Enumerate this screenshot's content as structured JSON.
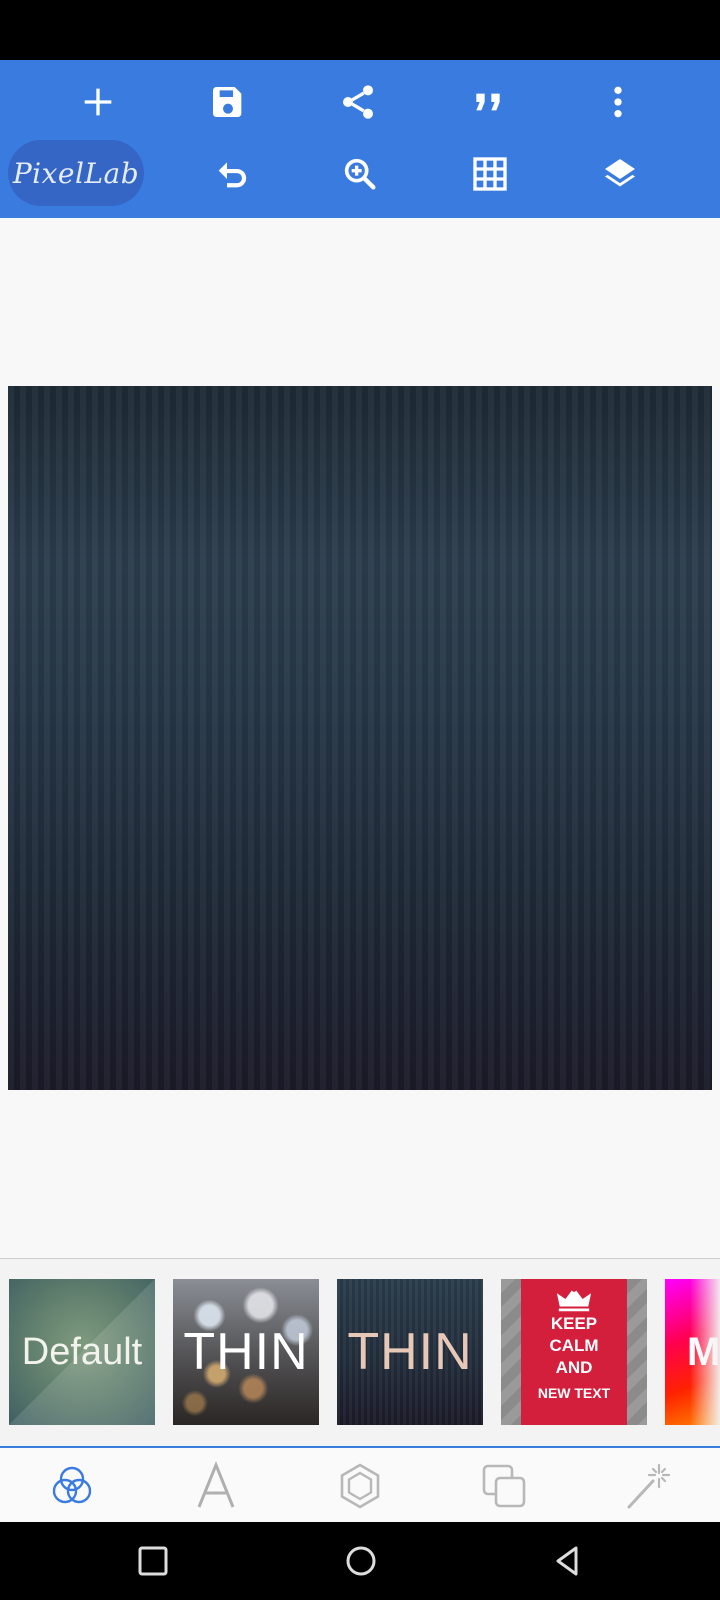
{
  "app": {
    "logo_text": "PixelLab",
    "accent_color": "#3a7be0"
  },
  "toolbar": {
    "top_row": [
      "plus-icon",
      "save-icon",
      "share-icon",
      "quote-icon",
      "more-vert-icon"
    ],
    "bottom_row": [
      "undo-icon",
      "zoom-in-icon",
      "grid-icon",
      "layers-icon"
    ]
  },
  "presets": {
    "default_label": "Default",
    "thin_label": "THIN",
    "thin2_label": "THIN",
    "keep_line1": "KEEP",
    "keep_line2": "CALM",
    "keep_line3": "AND",
    "keep_line4": "NEW TEXT",
    "partial_label": "M"
  },
  "bottom_tabs": [
    "blend-icon",
    "text-icon",
    "shape-icon",
    "copy-icon",
    "magic-wand-icon"
  ],
  "nav": [
    "recents-icon",
    "home-icon",
    "back-icon"
  ]
}
